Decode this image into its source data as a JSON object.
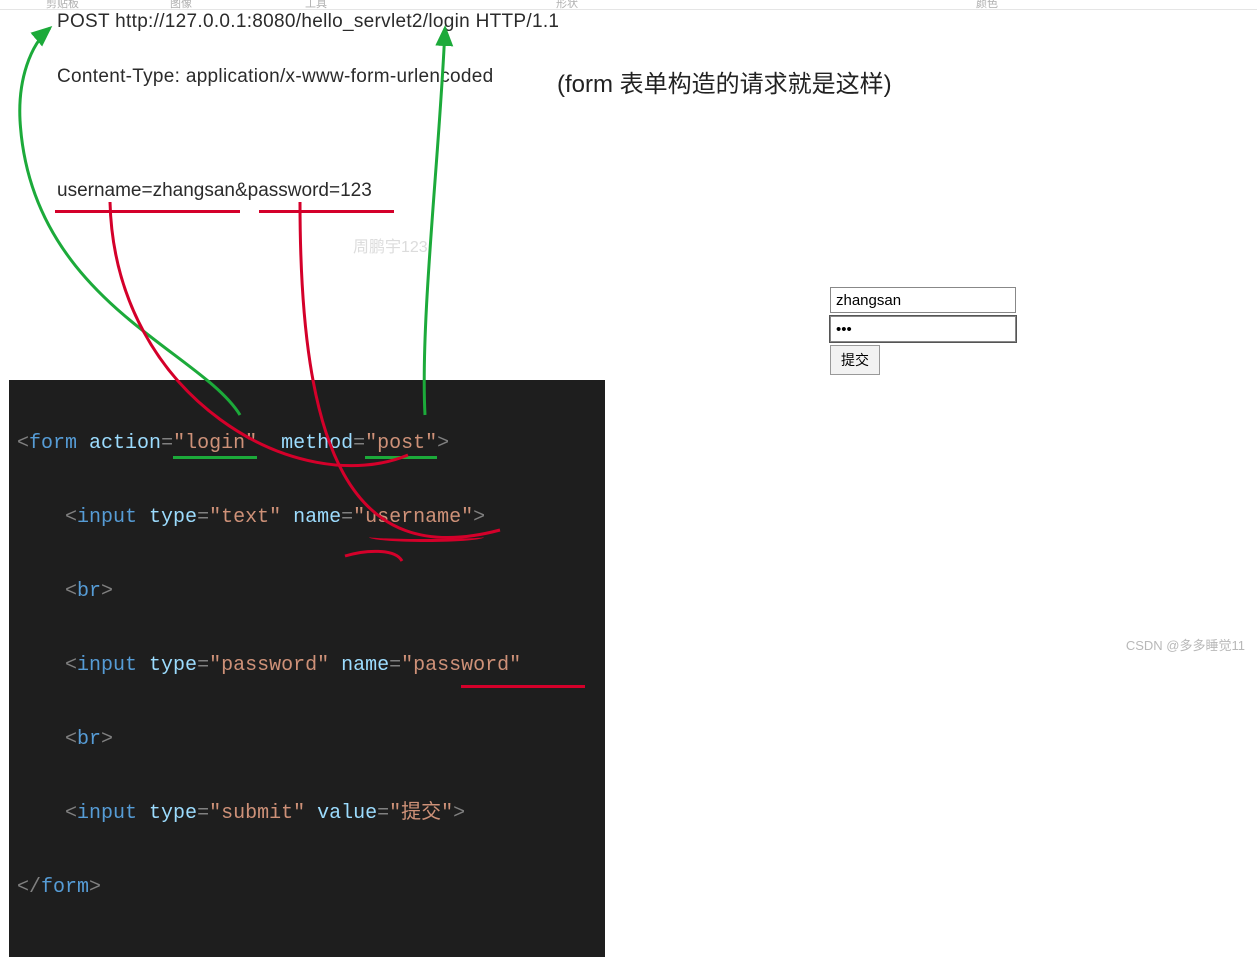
{
  "ribbon": {
    "clipboard": "剪贴板",
    "image": "图像",
    "tools": "工具",
    "shapes": "形状",
    "colors": "颜色"
  },
  "http": {
    "request_line": "POST http://127.0.0.1:8080/hello_servlet2/login HTTP/1.1",
    "content_type": "Content-Type: application/x-www-form-urlencoded",
    "body": "username=zhangsan&password=123"
  },
  "annotation": "(form 表单构造的请求就是这样)",
  "watermark_author": "周鹏宇123",
  "watermark_bg": "",
  "form_preview": {
    "username_value": "zhangsan",
    "password_value": "•••",
    "submit_label": "提交"
  },
  "code": {
    "form_open_prefix": "<",
    "form_tag": "form",
    "action_attr": "action",
    "action_val": "\"login\"",
    "method_attr": "method",
    "method_val": "\"post\"",
    "gt": ">",
    "lt": "<",
    "slash": "/",
    "input_tag": "input",
    "type_attr": "type",
    "text_val": "\"text\"",
    "name_attr": "name",
    "username_val": "\"username\"",
    "br_tag": "br",
    "password_val": "\"password\"",
    "password_name_val": "\"password\"",
    "submit_val": "\"submit\"",
    "value_attr": "value",
    "submit_label_val": "\"提交\"",
    "eq": "="
  },
  "footer": "CSDN @多多睡觉11"
}
